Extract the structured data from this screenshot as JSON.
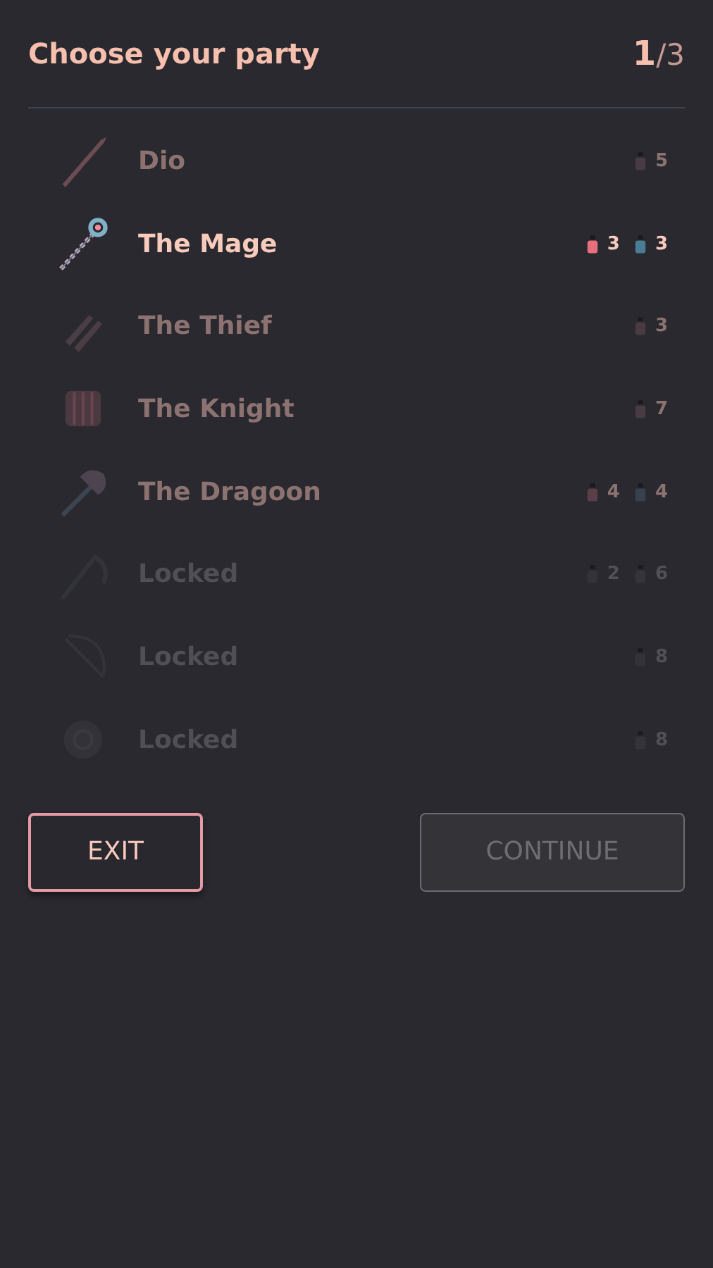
{
  "header": {
    "title": "Choose your party",
    "counter": "**1**/3"
  },
  "rows": [
    {
      "name": "Dio",
      "selected": false,
      "locked": false,
      "costs": [
        {
          "color": "#4a3a42",
          "amount": "5"
        }
      ]
    },
    {
      "name": "The Mage",
      "selected": true,
      "locked": false,
      "costs": [
        {
          "color": "#e8707e",
          "amount": "3"
        },
        {
          "color": "#4a7d95",
          "amount": "3"
        }
      ]
    },
    {
      "name": "The Thief",
      "selected": false,
      "locked": false,
      "costs": [
        {
          "color": "#4a3a42",
          "amount": "3"
        }
      ]
    },
    {
      "name": "The Knight",
      "selected": false,
      "locked": false,
      "costs": [
        {
          "color": "#4a3a42",
          "amount": "7"
        }
      ]
    },
    {
      "name": "The Dragoon",
      "selected": false,
      "locked": false,
      "costs": [
        {
          "color": "#5a3f48",
          "amount": "4"
        },
        {
          "color": "#36434e",
          "amount": "4"
        }
      ]
    },
    {
      "name": "Locked",
      "selected": false,
      "locked": true,
      "costs": [
        {
          "color": "#35333a",
          "amount": "2"
        },
        {
          "color": "#32353c",
          "amount": "6"
        }
      ]
    },
    {
      "name": "Locked",
      "selected": false,
      "locked": true,
      "costs": [
        {
          "color": "#35333a",
          "amount": "8"
        }
      ]
    },
    {
      "name": "Locked",
      "selected": false,
      "locked": true,
      "costs": [
        {
          "color": "#35333a",
          "amount": "8"
        }
      ]
    }
  ],
  "buttons": [
    {
      "label": "EXIT",
      "disabled": false
    },
    {
      "label": "CONTINUE",
      "disabled": true
    }
  ]
}
